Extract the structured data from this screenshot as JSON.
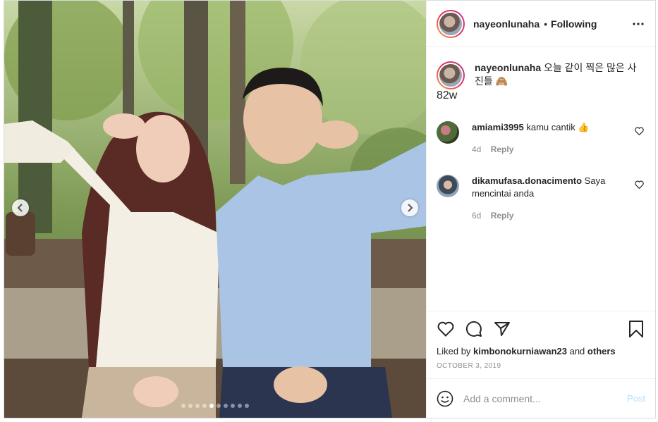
{
  "post": {
    "username": "nayeonlunaha",
    "follow_separator": "•",
    "follow_status": "Following",
    "caption_text": "오늘 같이 찍은 많은 사진들 🙈",
    "caption_time": "82w",
    "carousel": {
      "total_slides": 10,
      "active_index": 4
    },
    "comments": [
      {
        "username": "amiami3995",
        "text": "kamu cantik 👍",
        "time": "4d",
        "reply_label": "Reply"
      },
      {
        "username": "dikamufasa.donacimento",
        "text": "Saya mencintai anda",
        "time": "6d",
        "reply_label": "Reply"
      }
    ],
    "likes": {
      "prefix": "Liked by",
      "user": "kimbonokurniawan23",
      "joiner": "and",
      "others": "others"
    },
    "date": "OCTOBER 3, 2019",
    "add_comment": {
      "placeholder": "Add a comment...",
      "post_label": "Post"
    },
    "icons": {
      "more": "more-dots-icon",
      "like": "heart-icon",
      "comment": "comment-icon",
      "share": "share-icon",
      "save": "bookmark-icon",
      "emoji": "emoji-icon",
      "prev": "chevron-left-icon",
      "next": "chevron-right-icon"
    },
    "colors": {
      "text": "#262626",
      "muted": "#8e8e8e",
      "post_button": "#b2dffc",
      "border": "#dbdbdb"
    }
  }
}
